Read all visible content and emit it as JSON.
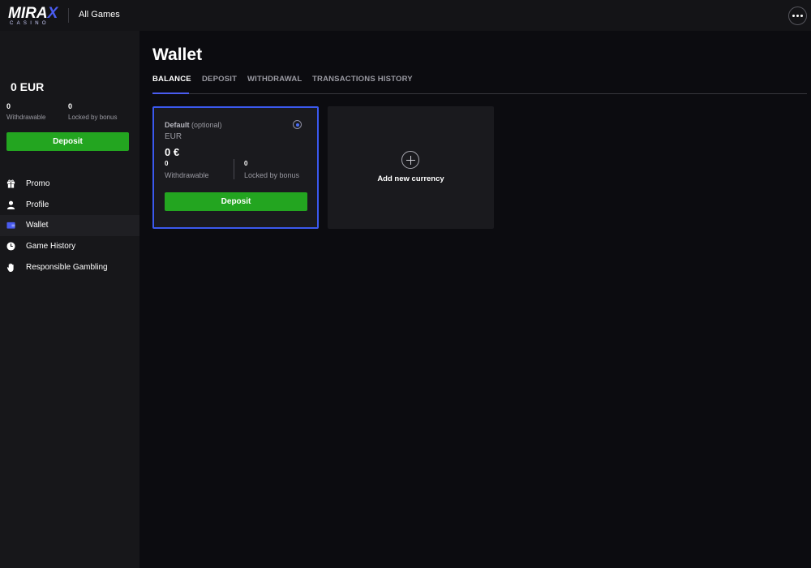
{
  "header": {
    "logo_text_a": "MIRA",
    "logo_text_x": "X",
    "logo_sub": "CASINO",
    "all_games": "All Games"
  },
  "sidebar": {
    "balance": "0 EUR",
    "withdrawable_value": "0",
    "withdrawable_label": "Withdrawable",
    "locked_value": "0",
    "locked_label": "Locked by bonus",
    "deposit_label": "Deposit",
    "items": [
      {
        "label": "Promo",
        "icon": "gift-icon"
      },
      {
        "label": "Profile",
        "icon": "user-icon"
      },
      {
        "label": "Wallet",
        "icon": "wallet-icon",
        "active": true
      },
      {
        "label": "Game History",
        "icon": "clock-icon"
      },
      {
        "label": "Responsible Gambling",
        "icon": "hand-icon"
      }
    ]
  },
  "main": {
    "title": "Wallet",
    "tabs": [
      {
        "label": "BALANCE",
        "active": true
      },
      {
        "label": "DEPOSIT"
      },
      {
        "label": "WITHDRAWAL"
      },
      {
        "label": "TRANSACTIONS HISTORY"
      }
    ],
    "currency_card": {
      "default_label": "Default",
      "optional_label": "(optional)",
      "currency": "EUR",
      "amount": "0 €",
      "withdrawable_value": "0",
      "withdrawable_label": "Withdrawable",
      "locked_value": "0",
      "locked_label": "Locked by bonus",
      "deposit_label": "Deposit"
    },
    "add_card": {
      "label": "Add new currency"
    }
  },
  "colors": {
    "accent": "#4a5cf0",
    "deposit_green": "#23a520",
    "background": "#0c0c10",
    "sidebar": "#17171a"
  }
}
